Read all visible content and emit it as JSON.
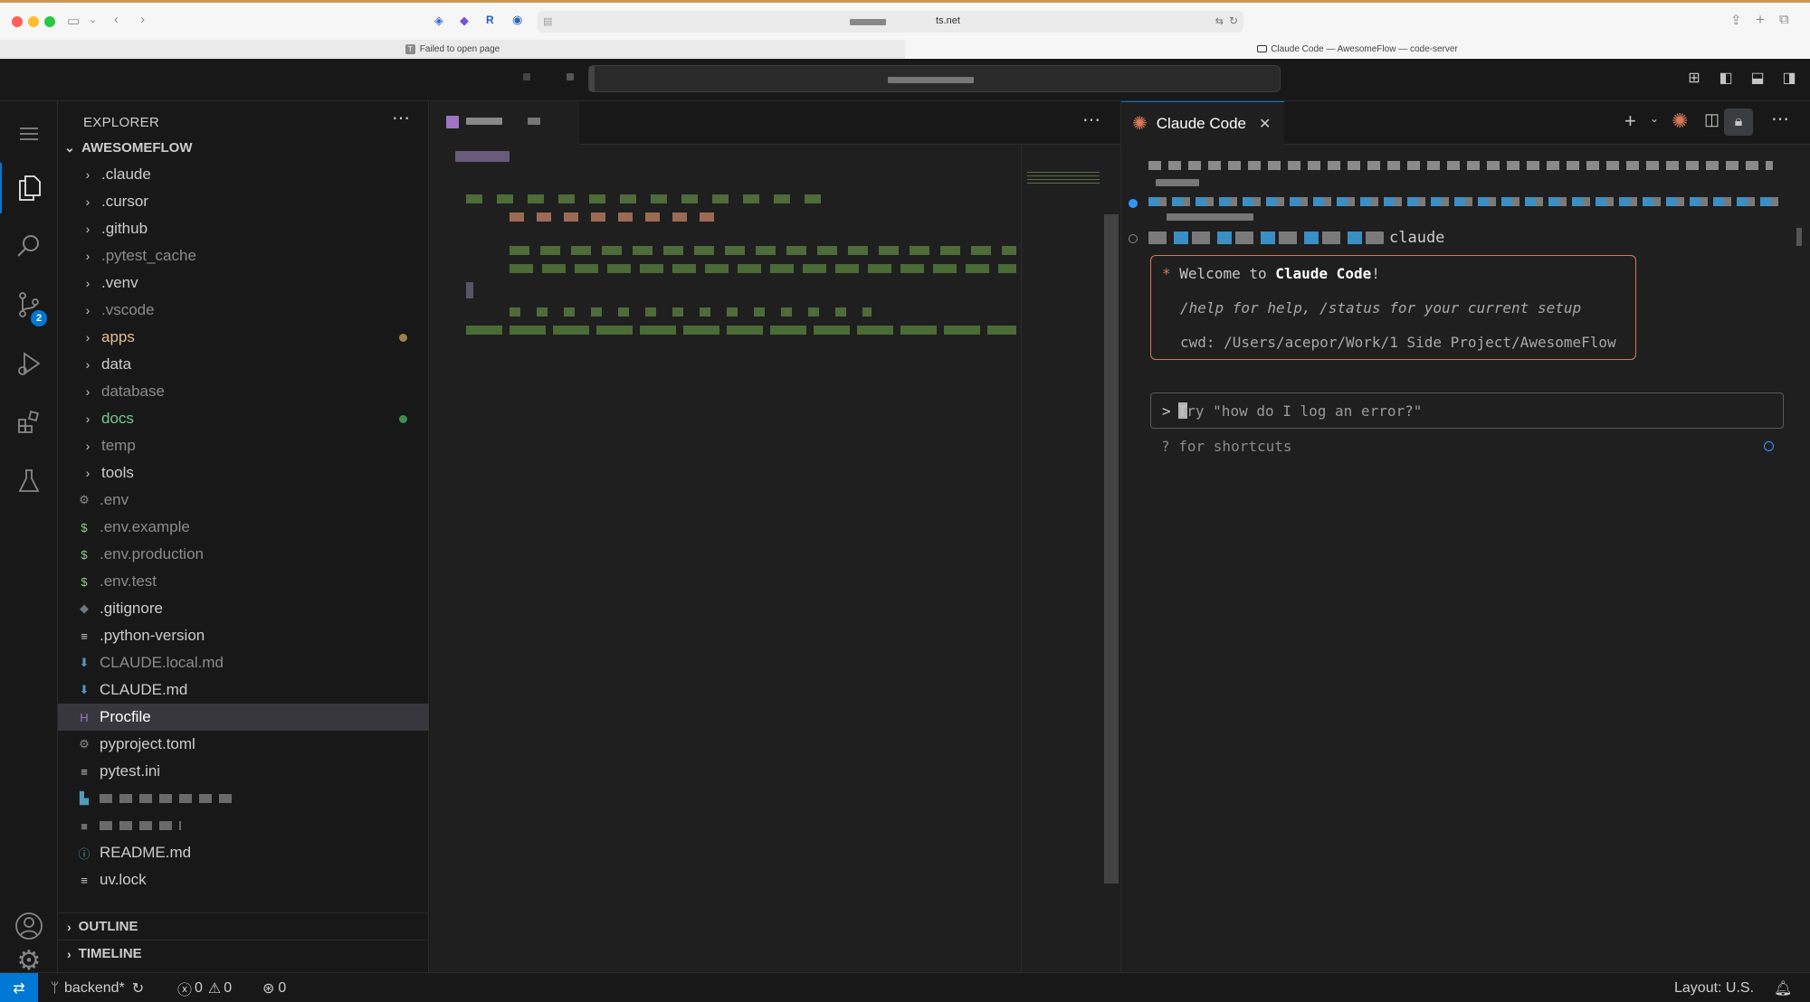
{
  "browser": {
    "url_text": "ts.net",
    "tabs": [
      {
        "title": "Failed to open page"
      },
      {
        "title": "Claude Code — AwesomeFlow — code-server"
      }
    ]
  },
  "explorer": {
    "title": "EXPLORER",
    "root": "AWESOMEFLOW",
    "folders": [
      {
        "name": ".claude",
        "color": "#cccccc"
      },
      {
        "name": ".cursor",
        "color": "#cccccc"
      },
      {
        "name": ".github",
        "color": "#cccccc"
      },
      {
        "name": ".pytest_cache",
        "color": "#8b8b8b"
      },
      {
        "name": ".venv",
        "color": "#cccccc"
      },
      {
        "name": ".vscode",
        "color": "#8b8b8b"
      },
      {
        "name": "apps",
        "color": "#e2c08d",
        "dot": "#9c7f4a"
      },
      {
        "name": "data",
        "color": "#cccccc"
      },
      {
        "name": "database",
        "color": "#8b8b8b"
      },
      {
        "name": "docs",
        "color": "#73c991",
        "dot": "#3e8e51"
      },
      {
        "name": "temp",
        "color": "#8b8b8b"
      },
      {
        "name": "tools",
        "color": "#cccccc"
      }
    ],
    "files": [
      {
        "name": ".env",
        "icon": "gear-icon",
        "glyph": "⚙",
        "icon_color": "#8a8a8a",
        "color": "#8b8b8b"
      },
      {
        "name": ".env.example",
        "icon": "dollar-icon",
        "glyph": "$",
        "icon_color": "#89d185",
        "color": "#8b8b8b"
      },
      {
        "name": ".env.production",
        "icon": "dollar-icon",
        "glyph": "$",
        "icon_color": "#89d185",
        "color": "#8b8b8b"
      },
      {
        "name": ".env.test",
        "icon": "dollar-icon",
        "glyph": "$",
        "icon_color": "#89d185",
        "color": "#8b8b8b"
      },
      {
        "name": ".gitignore",
        "icon": "git-icon",
        "glyph": "◆",
        "icon_color": "#6e7681",
        "color": "#cccccc"
      },
      {
        "name": ".python-version",
        "icon": "lines-icon",
        "glyph": "≡",
        "icon_color": "#cccccc",
        "color": "#cccccc"
      },
      {
        "name": "CLAUDE.local.md",
        "icon": "download-icon",
        "glyph": "⬇",
        "icon_color": "#519aba",
        "color": "#8b8b8b"
      },
      {
        "name": "CLAUDE.md",
        "icon": "download-icon",
        "glyph": "⬇",
        "icon_color": "#519aba",
        "color": "#cccccc"
      },
      {
        "name": "Procfile",
        "icon": "heroku-icon",
        "glyph": "H",
        "icon_color": "#a074c4",
        "color": "#ffffff",
        "selected": true
      },
      {
        "name": "pyproject.toml",
        "icon": "gear-icon",
        "glyph": "⚙",
        "icon_color": "#8a8a8a",
        "color": "#cccccc"
      },
      {
        "name": "pytest.ini",
        "icon": "lines-icon",
        "glyph": "≡",
        "icon_color": "#cccccc",
        "color": "#cccccc"
      },
      {
        "name": "",
        "icon": "blurred-file-icon",
        "glyph": "▙",
        "icon_color": "#519aba",
        "color": "#cccccc",
        "blurred": true
      },
      {
        "name": "",
        "icon": "blurred-file-icon",
        "glyph": "■",
        "icon_color": "#6d6d6d",
        "color": "#cccccc",
        "blurred": true
      },
      {
        "name": "README.md",
        "icon": "info-icon",
        "glyph": "ⓘ",
        "icon_color": "#519aba",
        "color": "#cccccc"
      },
      {
        "name": "uv.lock",
        "icon": "lines-icon",
        "glyph": "≡",
        "icon_color": "#cccccc",
        "color": "#cccccc"
      }
    ],
    "sections": [
      "OUTLINE",
      "TIMELINE"
    ]
  },
  "activity": {
    "scm_badge": "2"
  },
  "claude": {
    "tab_label": "Claude Code",
    "prompt_suffix": "claude",
    "welcome_prefix": "Welcome to ",
    "welcome_bold": "Claude Code",
    "welcome_suffix": "!",
    "help_line": "/help for help, /status for your current setup",
    "cwd_line": "cwd: /Users/acepor/Work/1 Side Project/AwesomeFlow",
    "input_caret": ">",
    "input_placeholder": "Try \"how do I log an error?\"",
    "shortcuts_hint": "? for shortcuts",
    "accent": "#d97757"
  },
  "statusbar": {
    "branch": "backend*",
    "errors": "0",
    "warnings": "0",
    "ports": "0",
    "layout": "Layout: U.S."
  }
}
